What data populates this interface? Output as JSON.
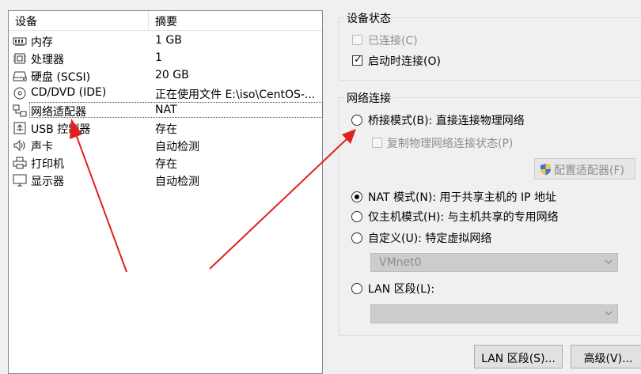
{
  "device_list": {
    "header": {
      "device": "设备",
      "summary": "摘要"
    },
    "rows": [
      {
        "icon": "memory-icon",
        "name": "内存",
        "summary": "1 GB"
      },
      {
        "icon": "processor-icon",
        "name": "处理器",
        "summary": "1"
      },
      {
        "icon": "hard-disk-icon",
        "name": "硬盘 (SCSI)",
        "summary": "20 GB"
      },
      {
        "icon": "cd-dvd-icon",
        "name": "CD/DVD (IDE)",
        "summary": "正在使用文件 E:\\iso\\CentOS-..."
      },
      {
        "icon": "network-adapter-icon",
        "name": "网络适配器",
        "summary": "NAT"
      },
      {
        "icon": "usb-icon",
        "name": "USB 控制器",
        "summary": "存在"
      },
      {
        "icon": "sound-card-icon",
        "name": "声卡",
        "summary": "自动检测"
      },
      {
        "icon": "printer-icon",
        "name": "打印机",
        "summary": "存在"
      },
      {
        "icon": "display-icon",
        "name": "显示器",
        "summary": "自动检测"
      }
    ],
    "selected": "网络适配器"
  },
  "device_status": {
    "title": "设备状态",
    "connected": {
      "label": "已连接(C)",
      "checked": false,
      "enabled": false
    },
    "connect_at_power_on": {
      "label": "启动时连接(O)",
      "checked": true,
      "enabled": true
    }
  },
  "network_connection": {
    "title": "网络连接",
    "bridged": {
      "label": "桥接模式(B): 直接连接物理网络",
      "selected": false
    },
    "replicate_state": {
      "label": "复制物理网络连接状态(P)",
      "checked": false,
      "enabled": false
    },
    "configure_adapters": {
      "label": "配置适配器(F)",
      "enabled": false
    },
    "nat": {
      "label": "NAT 模式(N): 用于共享主机的 IP 地址",
      "selected": true
    },
    "host_only": {
      "label": "仅主机模式(H): 与主机共享的专用网络",
      "selected": false
    },
    "custom": {
      "label": "自定义(U): 特定虚拟网络",
      "selected": false
    },
    "custom_network_select": {
      "value": "VMnet0",
      "enabled": false
    },
    "lan_segment": {
      "label": "LAN 区段(L):",
      "selected": false
    },
    "lan_segment_select": {
      "value": "",
      "enabled": false
    }
  },
  "buttons": {
    "lan_segments": "LAN 区段(S)...",
    "advanced": "高级(V)..."
  },
  "annotation_color": "#e02020"
}
